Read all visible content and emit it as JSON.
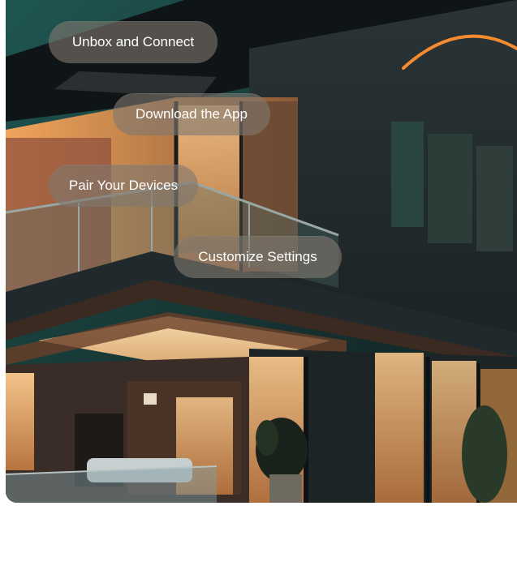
{
  "steps": [
    {
      "label": "Unbox and Connect"
    },
    {
      "label": "Download the App"
    },
    {
      "label": "Pair Your Devices"
    },
    {
      "label": "Customize Settings"
    }
  ],
  "colors": {
    "accent_orange": "#f58a2e",
    "pill_background": "#80786f",
    "sky": "#1e4a4a",
    "warm_light": "#f0b070"
  }
}
